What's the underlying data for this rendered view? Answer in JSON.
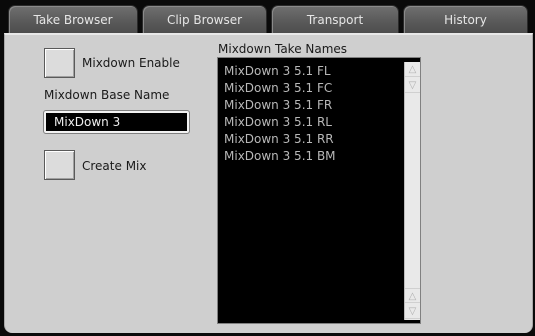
{
  "tabs": [
    {
      "label": "Take Browser"
    },
    {
      "label": "Clip Browser"
    },
    {
      "label": "Transport"
    },
    {
      "label": "History"
    }
  ],
  "mixdown_enable": {
    "label": "Mixdown Enable"
  },
  "base_name": {
    "label": "Mixdown Base Name",
    "value": "MixDown 3"
  },
  "create_mix": {
    "label": "Create Mix"
  },
  "take_names": {
    "label": "Mixdown Take Names",
    "items": [
      "MixDown 3 5.1 FL",
      "MixDown 3 5.1 FC",
      "MixDown 3 5.1 FR",
      "MixDown 3 5.1 RL",
      "MixDown 3 5.1 RR",
      "MixDown 3 5.1 BM"
    ]
  },
  "icons": {
    "scroll_up": "△",
    "scroll_down": "▽"
  }
}
